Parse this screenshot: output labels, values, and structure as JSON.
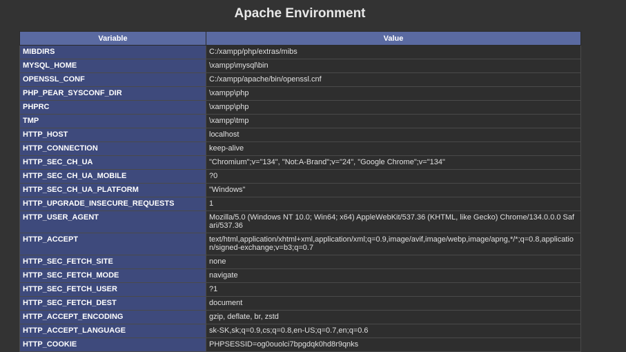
{
  "title": "Apache Environment",
  "table": {
    "headers": [
      "Variable",
      "Value"
    ],
    "rows": [
      {
        "name": "MIBDIRS",
        "value": "C:/xampp/php/extras/mibs"
      },
      {
        "name": "MYSQL_HOME",
        "value": "\\xampp\\mysql\\bin"
      },
      {
        "name": "OPENSSL_CONF",
        "value": "C:/xampp/apache/bin/openssl.cnf"
      },
      {
        "name": "PHP_PEAR_SYSCONF_DIR",
        "value": "\\xampp\\php"
      },
      {
        "name": "PHPRC",
        "value": "\\xampp\\php"
      },
      {
        "name": "TMP",
        "value": "\\xampp\\tmp"
      },
      {
        "name": "HTTP_HOST",
        "value": "localhost"
      },
      {
        "name": "HTTP_CONNECTION",
        "value": "keep-alive"
      },
      {
        "name": "HTTP_SEC_CH_UA",
        "value": "\"Chromium\";v=\"134\", \"Not:A-Brand\";v=\"24\", \"Google Chrome\";v=\"134\""
      },
      {
        "name": "HTTP_SEC_CH_UA_MOBILE",
        "value": "?0"
      },
      {
        "name": "HTTP_SEC_CH_UA_PLATFORM",
        "value": "\"Windows\""
      },
      {
        "name": "HTTP_UPGRADE_INSECURE_REQUESTS",
        "value": "1"
      },
      {
        "name": "HTTP_USER_AGENT",
        "value": "Mozilla/5.0 (Windows NT 10.0; Win64; x64) AppleWebKit/537.36 (KHTML, like Gecko) Chrome/134.0.0.0 Safari/537.36"
      },
      {
        "name": "HTTP_ACCEPT",
        "value": "text/html,application/xhtml+xml,application/xml;q=0.9,image/avif,image/webp,image/apng,*/*;q=0.8,application/signed-exchange;v=b3;q=0.7"
      },
      {
        "name": "HTTP_SEC_FETCH_SITE",
        "value": "none"
      },
      {
        "name": "HTTP_SEC_FETCH_MODE",
        "value": "navigate"
      },
      {
        "name": "HTTP_SEC_FETCH_USER",
        "value": "?1"
      },
      {
        "name": "HTTP_SEC_FETCH_DEST",
        "value": "document"
      },
      {
        "name": "HTTP_ACCEPT_ENCODING",
        "value": "gzip, deflate, br, zstd"
      },
      {
        "name": "HTTP_ACCEPT_LANGUAGE",
        "value": "sk-SK,sk;q=0.9,cs;q=0.8,en-US;q=0.7,en;q=0.6"
      },
      {
        "name": "HTTP_COOKIE",
        "value": "PHPSESSID=og0ouolci7bpgdqk0hd8r9qnks"
      }
    ]
  },
  "colors": {
    "background": "#333333",
    "header_bg": "#5a6aa1",
    "variable_bg": "#3e4a7c",
    "value_bg": "#2e2e2e"
  }
}
